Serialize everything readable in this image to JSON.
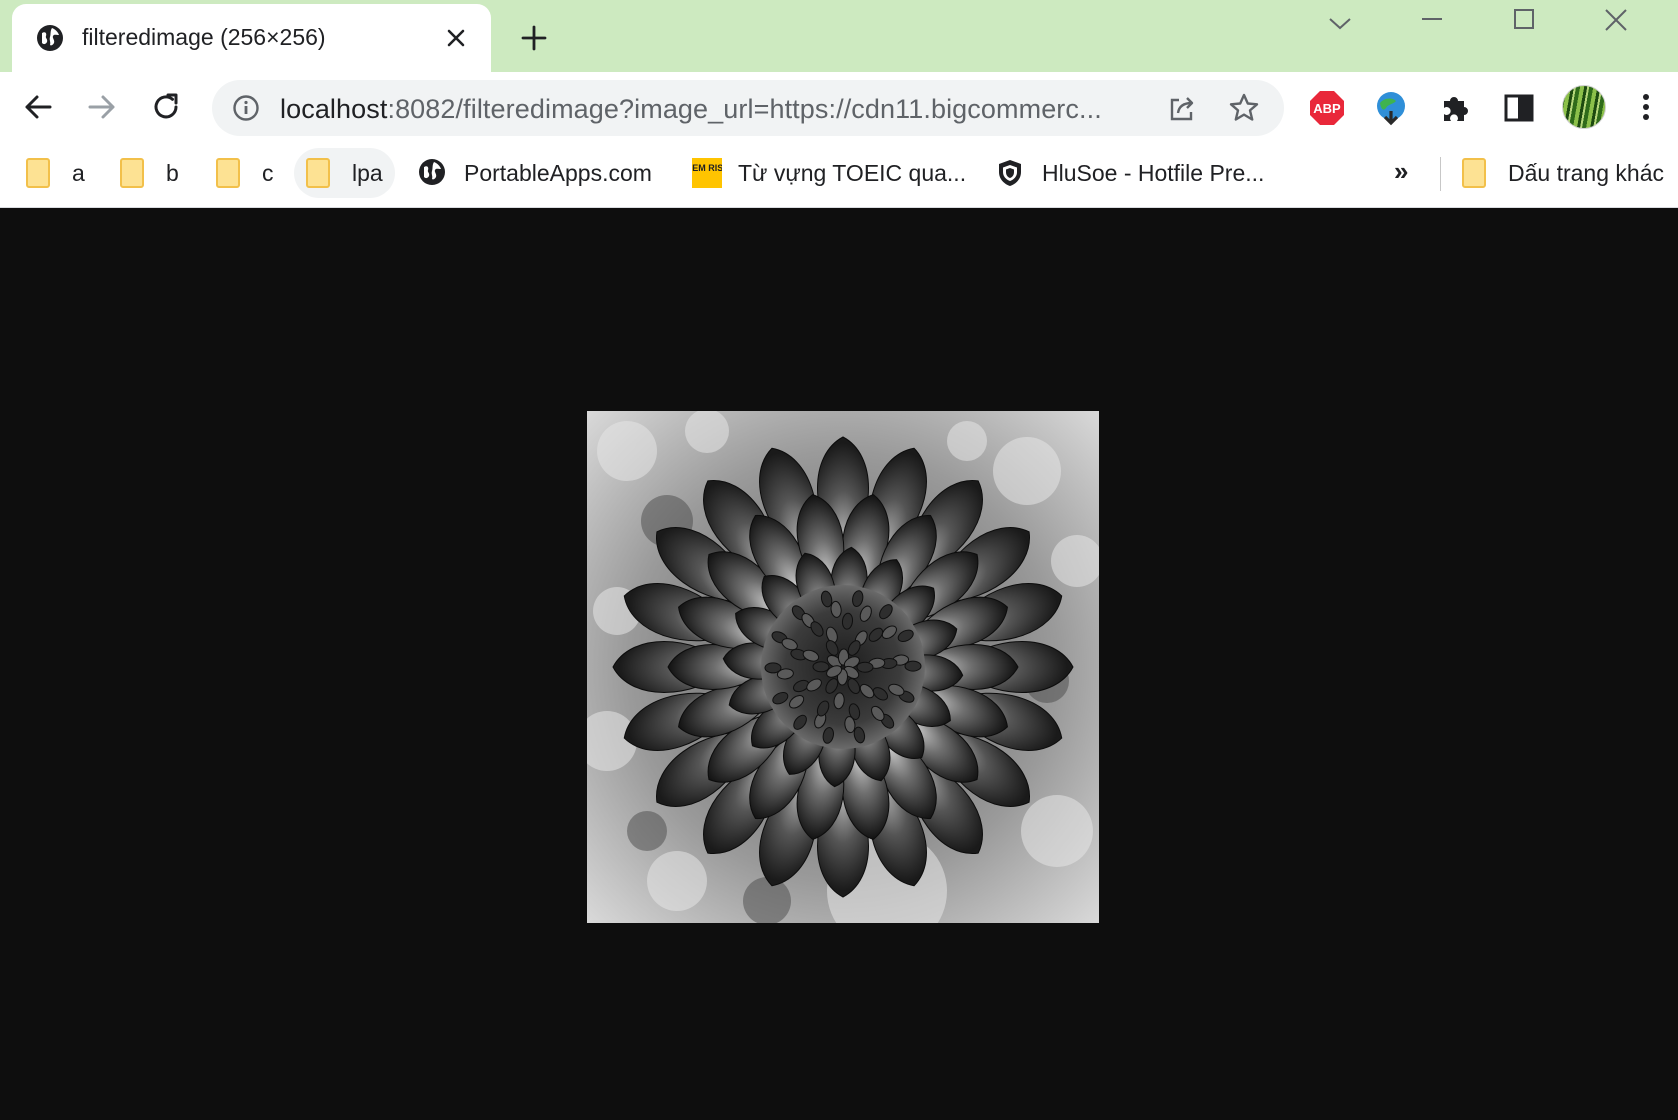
{
  "tab": {
    "title": "filteredimage (256×256)",
    "favicon": "globe-icon"
  },
  "window_controls": [
    "chevron-down-icon",
    "minimize-icon",
    "maximize-icon",
    "close-window-icon"
  ],
  "toolbar": {
    "url_host": "localhost",
    "url_rest": ":8082/filteredimage?image_url=https://cdn11.bigcommerc...",
    "extensions": [
      "adblock-plus-icon",
      "idm-icon",
      "extensions-puzzle-icon",
      "side-panel-icon"
    ]
  },
  "bookmarks": {
    "items": [
      {
        "label": "a",
        "icon": "folder-icon"
      },
      {
        "label": "b",
        "icon": "folder-icon"
      },
      {
        "label": "c",
        "icon": "folder-icon"
      },
      {
        "label": "lpa",
        "icon": "folder-icon"
      },
      {
        "label": "PortableApps.com",
        "icon": "globe-icon"
      },
      {
        "label": "Từ vựng TOEIC qua...",
        "icon": "memrise-icon",
        "icon_text": "MEM RISE"
      },
      {
        "label": "HluSoe - Hotfile Pre...",
        "icon": "shield-icon"
      }
    ],
    "overflow": "»",
    "other": "Dấu trang khác"
  },
  "content": {
    "image": "grayscale-dahlia-photo",
    "background": "#0e0e0e"
  },
  "colors": {
    "tabstrip": "#cdeac0",
    "omnibox": "#f1f3f4",
    "folder": "#fde293"
  }
}
